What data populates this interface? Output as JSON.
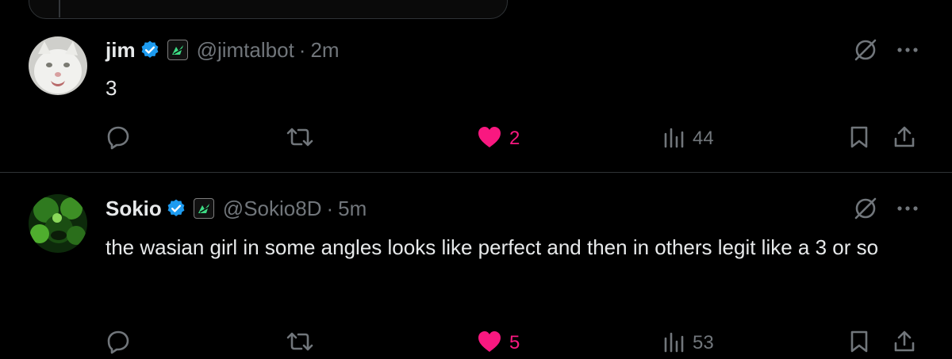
{
  "posts": [
    {
      "display_name": "jim",
      "handle": "@jimtalbot",
      "separator": "·",
      "time": "2m",
      "text": "3",
      "likes": "2",
      "views": "44",
      "liked": true,
      "avatar": "white-cat-avatar"
    },
    {
      "display_name": "Sokio",
      "handle": "@Sokio8D",
      "separator": "·",
      "time": "5m",
      "text": "the wasian girl in some angles looks like perfect and then in others legit like a 3 or so",
      "likes": "5",
      "views": "53",
      "liked": true,
      "avatar": "green-dark-avatar"
    }
  ],
  "icons": {
    "verified": "verified-badge-icon",
    "affiliate": "affiliate-badge-icon",
    "grok": "grok-icon",
    "more": "more-icon",
    "reply": "reply-icon",
    "repost": "repost-icon",
    "like": "heart-icon",
    "views": "views-icon",
    "bookmark": "bookmark-icon",
    "share": "share-icon"
  },
  "colors": {
    "background": "#000000",
    "text": "#e7e9ea",
    "muted": "#71767b",
    "like": "#f91880",
    "verified": "#1d9bf0",
    "affiliate_green": "#3ddc84"
  }
}
